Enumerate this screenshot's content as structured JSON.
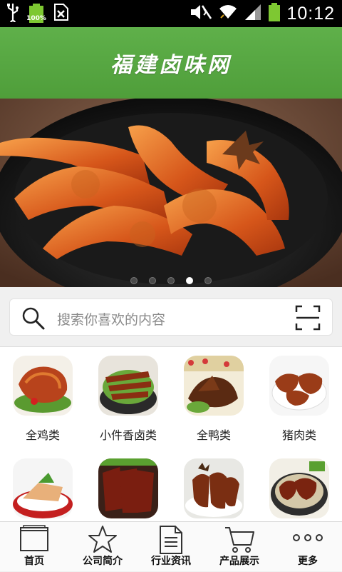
{
  "status_bar": {
    "battery_text": "100%",
    "time": "10:12"
  },
  "header": {
    "title": "福建卤味网"
  },
  "banner": {
    "slide_count": 5,
    "active_slide": 3
  },
  "search": {
    "placeholder": "搜索你喜欢的内容"
  },
  "categories": [
    {
      "label": "全鸡类"
    },
    {
      "label": "小件香卤类"
    },
    {
      "label": "全鸭类"
    },
    {
      "label": "猪肉类"
    },
    {
      "label": ""
    },
    {
      "label": ""
    },
    {
      "label": ""
    },
    {
      "label": ""
    }
  ],
  "tabs": [
    {
      "label": "首页",
      "icon": "folder-icon"
    },
    {
      "label": "公司简介",
      "icon": "star-icon"
    },
    {
      "label": "行业资讯",
      "icon": "document-icon"
    },
    {
      "label": "产品展示",
      "icon": "cart-icon"
    },
    {
      "label": "更多",
      "icon": "more-icon"
    }
  ],
  "colors": {
    "header_green": "#5fb04a",
    "status_battery": "#7ec832"
  }
}
